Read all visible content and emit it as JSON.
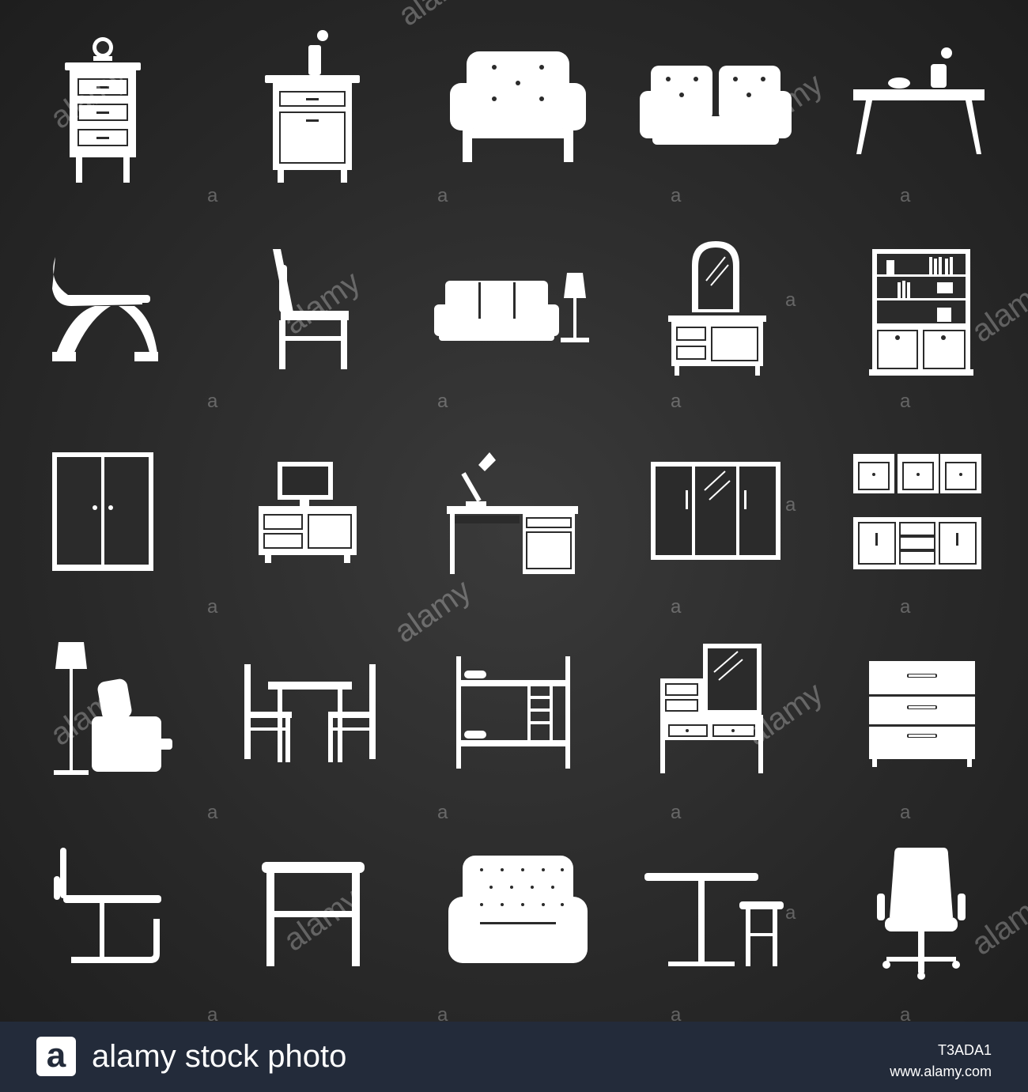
{
  "colors": {
    "background": "#2b2b2b",
    "icon": "#ffffff",
    "footer": "#232b3a",
    "footer_text": "#ffffff"
  },
  "watermark": {
    "word": "alamy",
    "letter": "a"
  },
  "icons": [
    "nightstand-clock-icon",
    "nightstand-vase-icon",
    "tufted-armchair-icon",
    "tufted-sofa-icon",
    "coffee-table-icon",
    "lounge-chair-icon",
    "dining-chair-icon",
    "sofa-lamp-icon",
    "vanity-mirror-icon",
    "bookcase-icon",
    "wardrobe-icon",
    "tv-stand-icon",
    "desk-lamp-icon",
    "mirror-wardrobe-icon",
    "kitchen-cabinets-icon",
    "recliner-lamp-icon",
    "dining-set-icon",
    "bunk-bed-icon",
    "dressing-table-icon",
    "dresser-icon",
    "cantilever-chair-icon",
    "stool-table-icon",
    "chesterfield-armchair-icon",
    "bar-table-stool-icon",
    "office-chair-icon"
  ],
  "footer": {
    "logo_letter": "a",
    "brand": "alamy stock photo",
    "image_id": "T3ADA1",
    "url": "www.alamy.com"
  }
}
